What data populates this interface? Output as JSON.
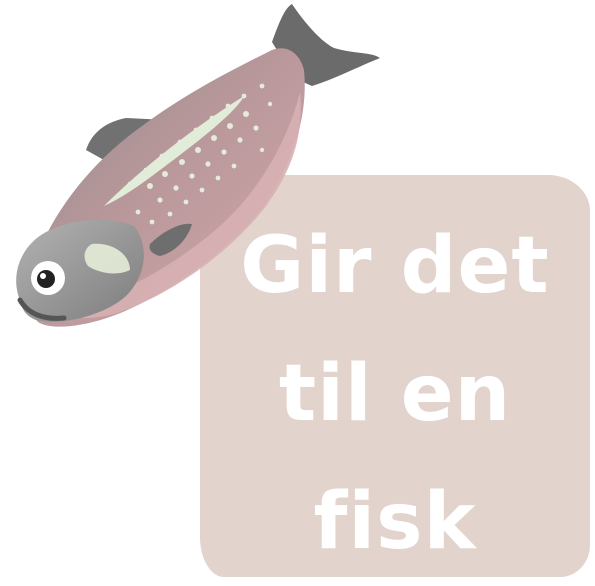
{
  "illustration": {
    "subject": "fish-icon",
    "colors": {
      "body": "#c59b9d",
      "back": "#8b8989",
      "belly": "#d4aeb0",
      "stripe": "#dfe9d6",
      "fin": "#6e6e6e",
      "head": "#9a9a9a"
    }
  },
  "caption": {
    "lines": [
      "Gir det",
      "til en",
      "fisk"
    ],
    "background": "#e2d3cc",
    "text_color": "#ffffff"
  }
}
